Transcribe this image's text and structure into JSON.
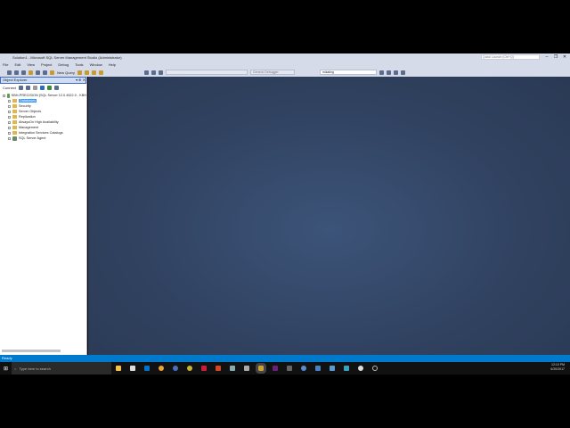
{
  "window": {
    "title": "Solution1 - Microsoft SQL Server Management Studio (Administrator)",
    "quick_launch_placeholder": "Quick Launch (Ctrl+Q)"
  },
  "menu": [
    "File",
    "Edit",
    "View",
    "Project",
    "Debug",
    "Tools",
    "Window",
    "Help"
  ],
  "toolbar": {
    "new_query": "New Query",
    "debugger_combo": "Generic Debugger",
    "database_combo": "mikaling"
  },
  "object_explorer": {
    "title": "Object Explorer",
    "connect": "Connect",
    "server": "KBH-PRECISION (SQL Server 12.0.4522.0 - KBH",
    "nodes": [
      "Databases",
      "Security",
      "Server Objects",
      "Replication",
      "AlwaysOn High Availability",
      "Management",
      "Integration Services Catalogs",
      "SQL Server Agent"
    ]
  },
  "status": "Ready",
  "taskbar": {
    "search_placeholder": "Type here to search",
    "time": "12:10 PM",
    "date": "6/20/2017"
  },
  "colors": {
    "accent": "#007acc",
    "background": "#2e3f5c"
  }
}
